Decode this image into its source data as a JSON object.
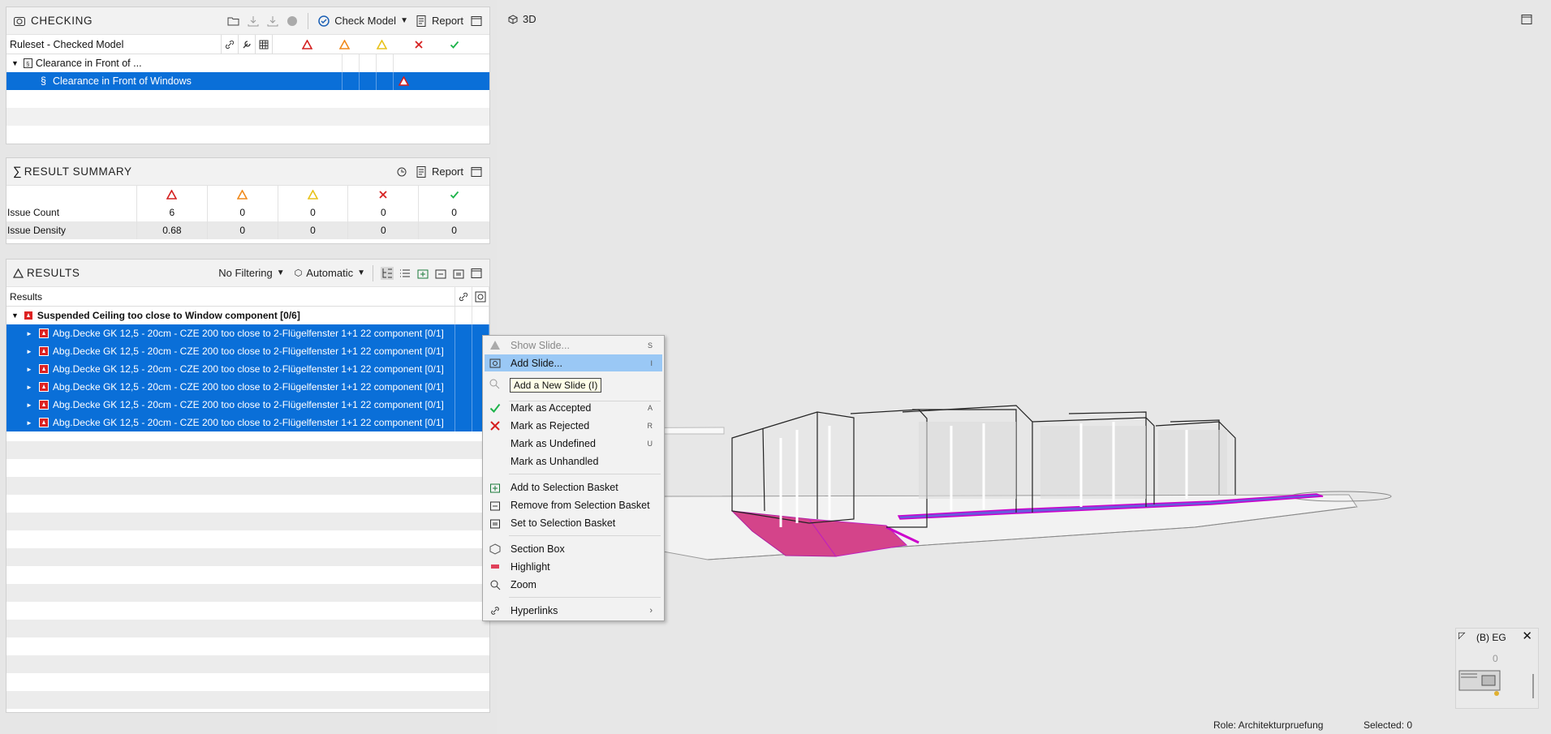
{
  "checking": {
    "title": "CHECKING",
    "check_model_label": "Check Model",
    "report_label": "Report",
    "columns": {
      "name": "Ruleset - Checked Model"
    },
    "rows": [
      {
        "label": "Clearance in Front of ..."
      },
      {
        "label": "Clearance in Front of Windows"
      }
    ]
  },
  "summary": {
    "title": "RESULT SUMMARY",
    "report_label": "Report",
    "rows": [
      {
        "label": "Issue Count",
        "values": [
          "6",
          "0",
          "0",
          "0",
          "0"
        ]
      },
      {
        "label": "Issue Density",
        "values": [
          "0.68",
          "0",
          "0",
          "0",
          "0"
        ]
      }
    ]
  },
  "results": {
    "title": "RESULTS",
    "filter_label": "No Filtering",
    "mode_label": "Automatic",
    "column_header": "Results",
    "group": "Suspended Ceiling too close to Window component [0/6]",
    "items": [
      "Abg.Decke GK 12,5 - 20cm - CZE 200 too close to 2-Flügelfenster 1+1 22 component [0/1]",
      "Abg.Decke GK 12,5 - 20cm - CZE 200 too close to 2-Flügelfenster 1+1 22 component [0/1]",
      "Abg.Decke GK 12,5 - 20cm - CZE 200 too close to 2-Flügelfenster 1+1 22 component [0/1]",
      "Abg.Decke GK 12,5 - 20cm - CZE 200 too close to 2-Flügelfenster 1+1 22 component [0/1]",
      "Abg.Decke GK 12,5 - 20cm - CZE 200 too close to 2-Flügelfenster 1+1 22 component [0/1]",
      "Abg.Decke GK 12,5 - 20cm - CZE 200 too close to 2-Flügelfenster 1+1 22 component [0/1]"
    ]
  },
  "viewport": {
    "title": "3D"
  },
  "context_menu": {
    "show_slide": {
      "label": "Show Slide...",
      "shortcut": "S"
    },
    "add_slide": {
      "label": "Add Slide...",
      "shortcut": "I"
    },
    "tooltip": "Add a New Slide (I)",
    "mark_accepted": {
      "label": "Mark as Accepted",
      "shortcut": "A"
    },
    "mark_rejected": {
      "label": "Mark as Rejected",
      "shortcut": "R"
    },
    "mark_undefined": {
      "label": "Mark as Undefined",
      "shortcut": "U"
    },
    "mark_unhandled": {
      "label": "Mark as Unhandled"
    },
    "add_basket": {
      "label": "Add to Selection Basket"
    },
    "remove_basket": {
      "label": "Remove from Selection Basket"
    },
    "set_basket": {
      "label": "Set to Selection Basket"
    },
    "section_box": {
      "label": "Section Box"
    },
    "highlight": {
      "label": "Highlight"
    },
    "zoom": {
      "label": "Zoom"
    },
    "hyperlinks": {
      "label": "Hyperlinks"
    }
  },
  "navigator": {
    "level": "(B) EG",
    "value": "0"
  },
  "status": {
    "role": "Role: Architekturpruefung",
    "selected": "Selected: 0"
  },
  "colors": {
    "selection": "#0a6fd8",
    "critical": "#d42020",
    "moderate": "#f08a1c",
    "minor": "#e8c21a",
    "rejected": "#d62020",
    "accepted": "#1db34a"
  }
}
